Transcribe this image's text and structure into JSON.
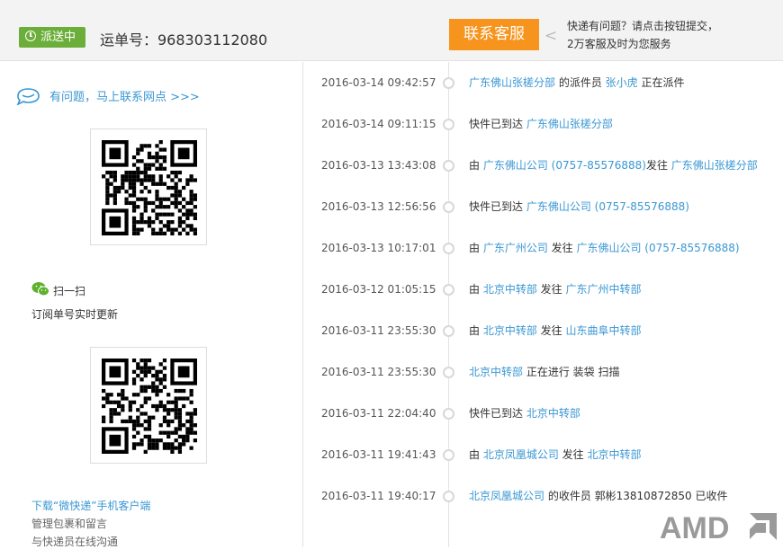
{
  "header": {
    "status": "派送中",
    "tracking": "运单号：968303112080",
    "contact_button": "联系客服",
    "contact_note_line1": "快递有问题？请点击按钮提交，",
    "contact_note_line2": "2万客服及时为您服务"
  },
  "sidebar": {
    "help_link": "有问题，马上联系网点 >>>",
    "scan_label": "扫一扫",
    "subscribe_label": "订阅单号实时更新",
    "download_link": "下载“微快递”手机客户端",
    "feature1": "管理包裹和留言",
    "feature2": "与快递员在线沟通"
  },
  "timeline": [
    {
      "time": "2016-03-14 09:42:57",
      "parts": [
        {
          "t": "广东佛山张槎分部",
          "l": true
        },
        {
          "t": " 的派件员 ",
          "l": false
        },
        {
          "t": "张小虎",
          "l": true
        },
        {
          "t": " 正在派件",
          "l": false
        }
      ]
    },
    {
      "time": "2016-03-14 09:11:15",
      "parts": [
        {
          "t": "快件已到达 ",
          "l": false
        },
        {
          "t": "广东佛山张槎分部",
          "l": true
        }
      ]
    },
    {
      "time": "2016-03-13 13:43:08",
      "parts": [
        {
          "t": "由 ",
          "l": false
        },
        {
          "t": "广东佛山公司 (0757-85576888)",
          "l": true
        },
        {
          "t": "发往 ",
          "l": false
        },
        {
          "t": "广东佛山张槎分部",
          "l": true
        }
      ]
    },
    {
      "time": "2016-03-13 12:56:56",
      "parts": [
        {
          "t": "快件已到达 ",
          "l": false
        },
        {
          "t": "广东佛山公司 (0757-85576888)",
          "l": true
        }
      ]
    },
    {
      "time": "2016-03-13 10:17:01",
      "parts": [
        {
          "t": "由 ",
          "l": false
        },
        {
          "t": "广东广州公司",
          "l": true
        },
        {
          "t": " 发往 ",
          "l": false
        },
        {
          "t": "广东佛山公司 (0757-85576888)",
          "l": true
        }
      ]
    },
    {
      "time": "2016-03-12 01:05:15",
      "parts": [
        {
          "t": "由 ",
          "l": false
        },
        {
          "t": "北京中转部",
          "l": true
        },
        {
          "t": " 发往 ",
          "l": false
        },
        {
          "t": "广东广州中转部",
          "l": true
        }
      ]
    },
    {
      "time": "2016-03-11 23:55:30",
      "parts": [
        {
          "t": "由 ",
          "l": false
        },
        {
          "t": "北京中转部",
          "l": true
        },
        {
          "t": " 发往 ",
          "l": false
        },
        {
          "t": "山东曲阜中转部",
          "l": true
        }
      ]
    },
    {
      "time": "2016-03-11 23:55:30",
      "parts": [
        {
          "t": "北京中转部",
          "l": true
        },
        {
          "t": " 正在进行 装袋 扫描",
          "l": false
        }
      ]
    },
    {
      "time": "2016-03-11 22:04:40",
      "parts": [
        {
          "t": "快件已到达 ",
          "l": false
        },
        {
          "t": "北京中转部",
          "l": true
        }
      ]
    },
    {
      "time": "2016-03-11 19:41:43",
      "parts": [
        {
          "t": "由 ",
          "l": false
        },
        {
          "t": "北京凤凰城公司",
          "l": true
        },
        {
          "t": " 发往 ",
          "l": false
        },
        {
          "t": "北京中转部",
          "l": true
        }
      ]
    },
    {
      "time": "2016-03-11 19:40:17",
      "parts": [
        {
          "t": "北京凤凰城公司",
          "l": true
        },
        {
          "t": " 的收件员 郭彬13810872850 已收件",
          "l": false
        }
      ]
    }
  ],
  "watermark": "AMD"
}
